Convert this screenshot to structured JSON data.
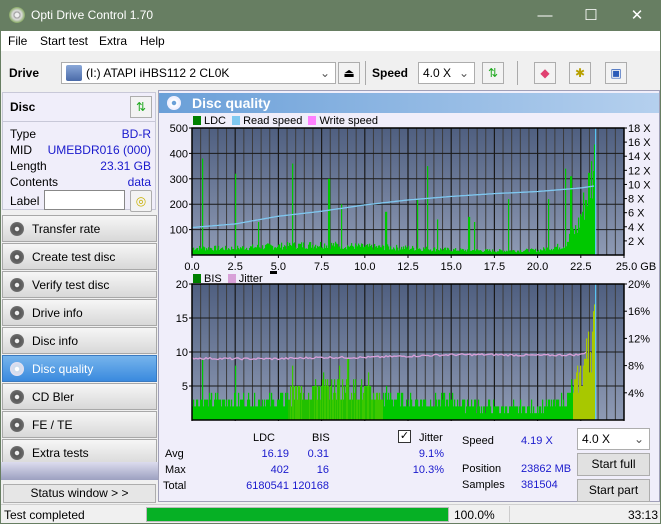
{
  "window": {
    "title": "Opti Drive Control 1.70",
    "minimize": "—",
    "maximize": "☐",
    "close": "✕"
  },
  "menu": [
    "File",
    "Start test",
    "Extra",
    "Help"
  ],
  "toolbar": {
    "drive_label": "Drive",
    "drive_value": "(I:)  ATAPI iHBS112  2 CL0K",
    "speed_label": "Speed",
    "speed_value": "4.0 X",
    "icons": [
      "eject-icon",
      "refresh-icon",
      "eraser-icon",
      "settings-icon",
      "save-icon"
    ]
  },
  "disc": {
    "title": "Disc",
    "rows": [
      {
        "label": "Type",
        "value": "BD-R"
      },
      {
        "label": "MID",
        "value": "UMEBDR016 (000)"
      },
      {
        "label": "Length",
        "value": "23.31 GB"
      },
      {
        "label": "Contents",
        "value": "data"
      }
    ],
    "label_field": "Label",
    "label_value": ""
  },
  "nav": [
    {
      "label": "Transfer rate",
      "active": false
    },
    {
      "label": "Create test disc",
      "active": false
    },
    {
      "label": "Verify test disc",
      "active": false
    },
    {
      "label": "Drive info",
      "active": false
    },
    {
      "label": "Disc info",
      "active": false
    },
    {
      "label": "Disc quality",
      "active": true
    },
    {
      "label": "CD Bler",
      "active": false
    },
    {
      "label": "FE / TE",
      "active": false
    },
    {
      "label": "Extra tests",
      "active": false
    }
  ],
  "status_window_btn": "Status window > >",
  "main": {
    "title": "Disc quality"
  },
  "colors": {
    "ldc": "#00c800",
    "ldc_legend": "#008000",
    "read_speed": "#7fc8f0",
    "write_speed": "#ff80ff",
    "bis_legend": "#008000",
    "jitter": "#d8a0d8",
    "plot_bg_top": "#4f5f80",
    "plot_bg_bottom": "#8e9ab4",
    "progress": "#06b025"
  },
  "chart_data": [
    {
      "type": "area",
      "title": "LDC / Read speed",
      "legend": [
        "LDC",
        "Read speed",
        "Write speed"
      ],
      "x_ticks": [
        "0.0",
        "2.5",
        "5.0",
        "7.5",
        "10.0",
        "12.5",
        "15.0",
        "17.5",
        "20.0",
        "22.5",
        "25.0 GB"
      ],
      "xlim": [
        0,
        25
      ],
      "y_left_ticks": [
        "100",
        "200",
        "300",
        "400",
        "500"
      ],
      "ylim_left": [
        0,
        500
      ],
      "y_right_ticks": [
        "2 X",
        "4 X",
        "6 X",
        "8 X",
        "10 X",
        "12 X",
        "14 X",
        "16 X",
        "18 X"
      ],
      "ylim_right": [
        0,
        18
      ],
      "ldc_baseline": [
        [
          0,
          30
        ],
        [
          2,
          28
        ],
        [
          5,
          38
        ],
        [
          7.5,
          45
        ],
        [
          10,
          35
        ],
        [
          12.5,
          30
        ],
        [
          15,
          22
        ],
        [
          17.5,
          18
        ],
        [
          20,
          20
        ],
        [
          21.5,
          40
        ],
        [
          22.3,
          120
        ],
        [
          22.8,
          250
        ],
        [
          23.3,
          400
        ]
      ],
      "ldc_spikes": [
        [
          0.6,
          380
        ],
        [
          2.5,
          320
        ],
        [
          3.8,
          130
        ],
        [
          5.8,
          360
        ],
        [
          7.9,
          300
        ],
        [
          8.6,
          200
        ],
        [
          11.2,
          170
        ],
        [
          13,
          220
        ],
        [
          13.6,
          350
        ],
        [
          14.2,
          140
        ],
        [
          16,
          150
        ],
        [
          16.3,
          130
        ],
        [
          18.3,
          220
        ],
        [
          20.6,
          220
        ],
        [
          21.6,
          340
        ],
        [
          21.9,
          310
        ]
      ],
      "read_speed": [
        [
          0,
          3.9
        ],
        [
          1,
          4.1
        ],
        [
          2.5,
          4.4
        ],
        [
          5,
          5.5
        ],
        [
          7.5,
          6.2
        ],
        [
          10,
          7.1
        ],
        [
          12.5,
          7.8
        ],
        [
          15,
          8.3
        ],
        [
          17.5,
          8.7
        ],
        [
          20,
          9.0
        ],
        [
          22.5,
          9.5
        ],
        [
          23.3,
          9.8
        ]
      ],
      "end_marker_x": 23.3
    },
    {
      "type": "area",
      "title": "BIS / Jitter",
      "legend": [
        "BIS",
        "Jitter"
      ],
      "x_ticks": [
        "0.0",
        "2.5",
        "5.0",
        "7.5",
        "10.0",
        "12.5",
        "15.0",
        "17.5",
        "20.0",
        "22.5",
        "25.0 GB"
      ],
      "xlim": [
        0,
        25
      ],
      "y_left_ticks": [
        "5",
        "10",
        "15",
        "20"
      ],
      "ylim_left": [
        0,
        20
      ],
      "y_right_ticks": [
        "4%",
        "8%",
        "12%",
        "16%",
        "20%"
      ],
      "ylim_right": [
        0,
        20
      ],
      "bis_profile": [
        [
          0,
          3
        ],
        [
          2.5,
          3
        ],
        [
          5,
          3
        ],
        [
          5.6,
          4
        ],
        [
          7,
          5
        ],
        [
          9,
          5
        ],
        [
          10.5,
          4
        ],
        [
          12.5,
          3
        ],
        [
          15,
          3
        ],
        [
          17.5,
          2
        ],
        [
          20,
          2
        ],
        [
          21.5,
          3
        ],
        [
          22.3,
          6
        ],
        [
          22.8,
          10
        ],
        [
          23.3,
          14
        ]
      ],
      "bis_spikes": [
        [
          0.6,
          9
        ],
        [
          2.5,
          8
        ],
        [
          5.8,
          8
        ],
        [
          7.6,
          7
        ],
        [
          8.5,
          8
        ],
        [
          9,
          9
        ],
        [
          10.2,
          7
        ],
        [
          22.9,
          13
        ],
        [
          23.2,
          16
        ]
      ],
      "jitter": [
        [
          0,
          9.1
        ],
        [
          2.5,
          9.0
        ],
        [
          5,
          9.0
        ],
        [
          7.5,
          9.2
        ],
        [
          10,
          9.2
        ],
        [
          12.5,
          9.4
        ],
        [
          15,
          9.6
        ],
        [
          17.5,
          9.6
        ],
        [
          20,
          9.5
        ],
        [
          22.5,
          9.6
        ],
        [
          22.9,
          10.2
        ]
      ],
      "end_marker_x": 23.3
    }
  ],
  "stats": {
    "headers": [
      "LDC",
      "BIS"
    ],
    "jitter_label": "Jitter",
    "jitter_checked": true,
    "rows": [
      {
        "label": "Avg",
        "ldc": "16.19",
        "bis": "0.31",
        "jitter": "9.1%"
      },
      {
        "label": "Max",
        "ldc": "402",
        "bis": "16",
        "jitter": "10.3%"
      },
      {
        "label": "Total",
        "ldc": "6180541",
        "bis": "120168",
        "jitter": ""
      }
    ],
    "speed_label": "Speed",
    "speed_value": "4.19 X",
    "position_label": "Position",
    "position_value": "23862 MB",
    "samples_label": "Samples",
    "samples_value": "381504",
    "speed_select": "4.0 X",
    "start_full": "Start full",
    "start_part": "Start part"
  },
  "status": {
    "text": "Test completed",
    "progress": 100.0,
    "progress_text": "100.0%",
    "time": "33:13"
  }
}
